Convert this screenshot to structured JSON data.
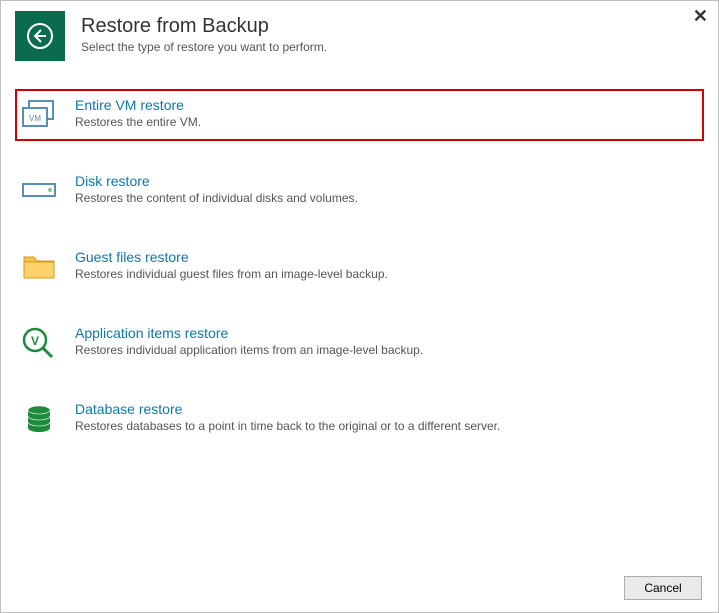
{
  "header": {
    "title": "Restore from Backup",
    "subtitle": "Select the type of restore you want to perform."
  },
  "options": [
    {
      "title": "Entire VM restore",
      "desc": "Restores the entire VM.",
      "highlight": true
    },
    {
      "title": "Disk restore",
      "desc": "Restores the content of individual disks and volumes."
    },
    {
      "title": "Guest files restore",
      "desc": "Restores individual guest files from an image-level backup."
    },
    {
      "title": "Application items restore",
      "desc": "Restores individual application items from an image-level backup."
    },
    {
      "title": "Database restore",
      "desc": "Restores databases to a point in time back to the original or to a different server."
    }
  ],
  "footer": {
    "cancel": "Cancel"
  }
}
